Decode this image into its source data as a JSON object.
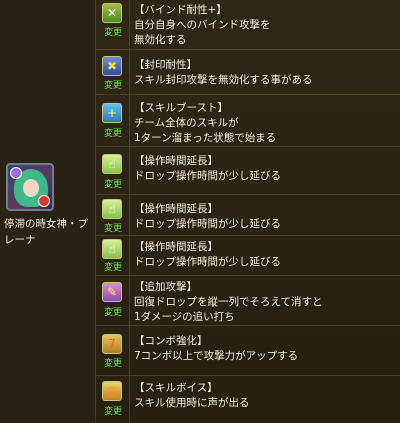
{
  "monster": {
    "name": "停滞の時女神・プレーナ"
  },
  "change_label": "変更",
  "awakenings": [
    {
      "icon": "bind-resist-plus-icon",
      "title": "【バインド耐性+】",
      "desc": [
        "自分自身へのバインド攻撃を",
        "無効化する"
      ]
    },
    {
      "icon": "seal-resist-icon",
      "title": "【封印耐性】",
      "desc": [
        "スキル封印攻撃を無効化する事がある"
      ]
    },
    {
      "icon": "skill-boost-icon",
      "title": "【スキルブースト】",
      "desc": [
        "チーム全体のスキルが",
        "1ターン溜まった状態で始まる"
      ]
    },
    {
      "icon": "extend-time-icon",
      "title": "【操作時間延長】",
      "desc": [
        "ドロップ操作時間が少し延びる"
      ]
    },
    {
      "icon": "extend-time-icon",
      "title": "【操作時間延長】",
      "desc": [
        "ドロップ操作時間が少し延びる"
      ]
    },
    {
      "icon": "extend-time-icon",
      "title": "【操作時間延長】",
      "desc": [
        "ドロップ操作時間が少し延びる"
      ]
    },
    {
      "icon": "additional-attack-icon",
      "title": "【追加攻撃】",
      "desc": [
        "回復ドロップを縦一列でそろえて消すと",
        "1ダメージの追い打ち"
      ]
    },
    {
      "icon": "combo-enhance-icon",
      "title": "【コンボ強化】",
      "desc": [
        "7コンボ以上で攻撃力がアップする"
      ]
    },
    {
      "icon": "skill-voice-icon",
      "title": "【スキルボイス】",
      "desc": [
        "スキル使用時に声が出る"
      ]
    }
  ]
}
